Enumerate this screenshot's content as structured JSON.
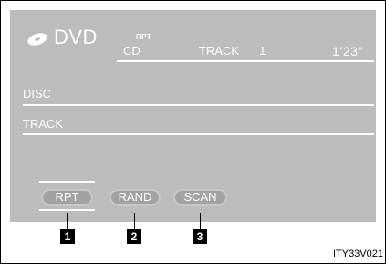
{
  "header": {
    "logo_icon": "disc-icon",
    "source_label": "DVD",
    "repeat_indicator": "RPT",
    "media_label": "CD",
    "track_label": "TRACK",
    "track_number": "1",
    "elapsed_time": "1’23\""
  },
  "info": {
    "disc_label": "DISC",
    "track_label": "TRACK"
  },
  "buttons": {
    "repeat_label": "RPT",
    "random_label": "RAND",
    "scan_label": "SCAN"
  },
  "callouts": [
    "1",
    "2",
    "3"
  ],
  "figure_code": "ITY33V021",
  "colors": {
    "screen_background": "#bcbcbc",
    "button_fill": "#a2a2a2",
    "text": "#ffffff"
  }
}
